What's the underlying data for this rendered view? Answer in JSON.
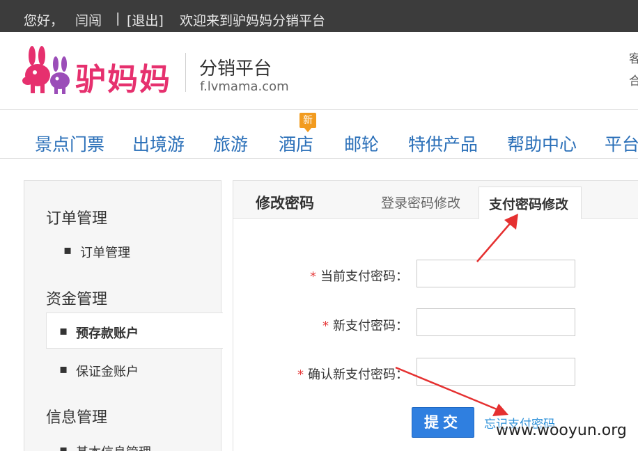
{
  "topbar": {
    "greeting": "您好，",
    "username": "闫闯",
    "separator": "|",
    "logout": "[退出]",
    "welcome": "欢迎来到驴妈妈分销平台"
  },
  "header": {
    "logo_text": "驴妈妈",
    "platform_title": "分销平台",
    "platform_url": "f.lvmama.com",
    "right_line_1": "客",
    "right_line_2": "合"
  },
  "nav": {
    "items": [
      "景点门票",
      "出境游",
      "旅游",
      "酒店",
      "邮轮",
      "特供产品",
      "帮助中心",
      "平台"
    ],
    "new_badge": "新"
  },
  "sidebar": {
    "groups": [
      {
        "title": "订单管理",
        "items": [
          "订单管理"
        ]
      },
      {
        "title": "资金管理",
        "items": [
          "预存款账户",
          "保证金账户"
        ]
      },
      {
        "title": "信息管理",
        "items": [
          "基本信息管理"
        ]
      }
    ],
    "bullet": "▪"
  },
  "panel": {
    "title": "修改密码",
    "tabs": [
      "登录密码修改",
      "支付密码修改"
    ],
    "active_tab": "支付密码修改",
    "required_mark": "*",
    "fields": [
      {
        "label": "当前支付密码：",
        "value": ""
      },
      {
        "label": "新支付密码：",
        "value": ""
      },
      {
        "label": "确认新支付密码：",
        "value": ""
      }
    ],
    "submit_label": "提交",
    "forgot_link": "忘记支付密码"
  },
  "watermark": "www.wooyun.org",
  "colors": {
    "topbar_bg": "#3c3c3c",
    "brand_pink": "#e6306e",
    "nav_blue": "#2a6fb8",
    "submit_blue": "#2f7fe0",
    "link_blue": "#2a8fd8",
    "required_red": "#e63a3a",
    "badge_orange": "#f29b1f",
    "arrow_red": "#e53030"
  }
}
